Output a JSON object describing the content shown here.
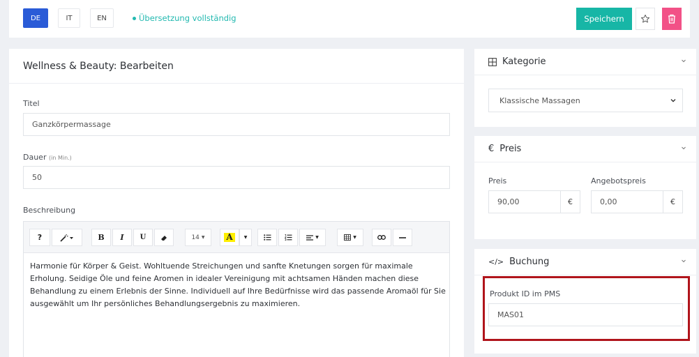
{
  "topbar": {
    "languages": [
      {
        "label": "DE",
        "active": true
      },
      {
        "label": "IT",
        "active": false
      },
      {
        "label": "EN",
        "active": false
      }
    ],
    "status": "Übersetzung vollständig",
    "save_label": "Speichern",
    "star_icon": "star-icon",
    "delete_icon": "trash-icon"
  },
  "main": {
    "title": "Wellness & Beauty: Bearbeiten",
    "titel_label": "Titel",
    "titel_value": "Ganzkörpermassage",
    "dauer_label": "Dauer",
    "dauer_unit": "(in Min.)",
    "dauer_value": "50",
    "beschreibung_label": "Beschreibung",
    "toolbar": {
      "help": "?",
      "font_size": "14",
      "color_letter": "A"
    },
    "editor_text": "Harmonie für Körper & Geist. Wohltuende Streichungen und sanfte Knetungen sorgen für maximale Erholung. Seidige Öle und feine Aromen in idealer Vereinigung mit achtsamen Händen machen diese Behandlung zu einem Erlebnis der Sinne. Individuell auf Ihre Bedürfnisse wird das passende Aromaöl für Sie ausgewählt um Ihr persönliches Behandlungsergebnis zu maximieren."
  },
  "kategorie": {
    "title": "Kategorie",
    "selected": "Klassische Massagen"
  },
  "preis": {
    "title": "Preis",
    "currency_symbol": "€",
    "preis_label": "Preis",
    "preis_value": "90,00",
    "angebot_label": "Angebotspreis",
    "angebot_value": "0,00",
    "unit": "€"
  },
  "buchung": {
    "title": "Buchung",
    "icon_text": "</>",
    "pms_label": "Produkt ID im PMS",
    "pms_value": "MAS01"
  },
  "colors": {
    "primary": "#2a5bd7",
    "save": "#17b6a6",
    "delete": "#f25187",
    "status": "#23b9b0",
    "highlight": "#b0141b"
  }
}
